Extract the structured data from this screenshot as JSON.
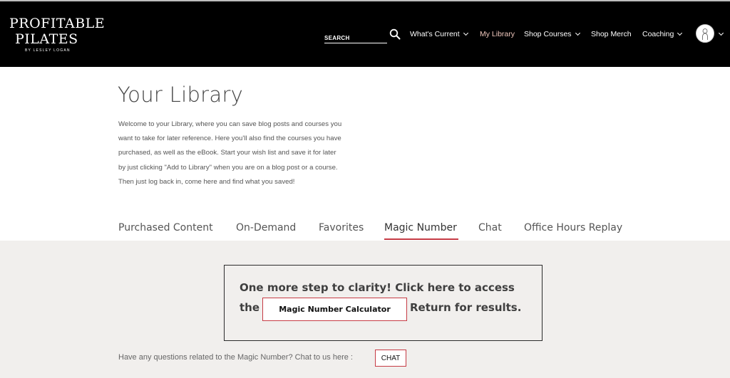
{
  "header": {
    "logo": {
      "line1": "PROFITABLE",
      "line2": "PILATES",
      "byline": "BY LESLEY LOGAN"
    },
    "search": {
      "placeholder": "SEARCH"
    },
    "nav": [
      {
        "label": "What's Current",
        "has_dropdown": true
      },
      {
        "label": "My Library",
        "active": true
      },
      {
        "label": "Shop Courses",
        "has_dropdown": true
      },
      {
        "label": "Shop Merch"
      },
      {
        "label": "Coaching",
        "has_dropdown": true
      }
    ],
    "icons": {
      "search": "search-icon",
      "avatar": "user-avatar-icon"
    }
  },
  "main": {
    "title": "Your Library",
    "intro_lines": [
      "Welcome to your Library, where you can save blog posts and courses you",
      "want to take for later reference. Here you'll also find the courses you have",
      "purchased, as well as the eBook. Start your wish list and save it for later",
      "by just clicking \"Add to Library\" when you are on a blog post or a course.",
      "Then just log back in, come here and find what you saved!"
    ],
    "tabs": [
      {
        "label": "Purchased Content"
      },
      {
        "label": "On-Demand"
      },
      {
        "label": "Favorites"
      },
      {
        "label": "Magic Number",
        "active": true
      },
      {
        "label": "Chat"
      },
      {
        "label": "Office Hours Replay"
      }
    ],
    "magic_number": {
      "cta_line1": "One more step to clarity! Click here to access",
      "cta_the": "the",
      "calc_button": "Magic Number Calculator",
      "cta_return": "Return for results.",
      "question": "Have any questions related to the Magic Number? Chat to us here :",
      "chat_button": "CHAT"
    }
  },
  "colors": {
    "header_bg": "#000000",
    "active_nav": "#f0c8bd",
    "accent_red": "#c63b45",
    "panel_bg": "#f1efed"
  }
}
